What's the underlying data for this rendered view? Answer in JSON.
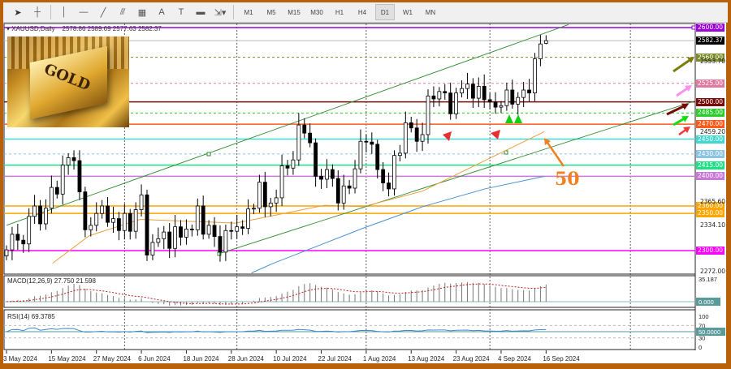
{
  "toolbar": {
    "tools": [
      "cursor-icon",
      "crosshair-icon",
      "vertical-line-icon",
      "horizontal-line-icon",
      "trendline-icon",
      "fibonacci-icon",
      "fibo-fan-icon",
      "text-icon",
      "text-label-icon",
      "rectangle-icon",
      "arrows-icon"
    ],
    "text_tool": "A",
    "timeframes": [
      "M1",
      "M5",
      "M15",
      "M30",
      "H1",
      "H4",
      "D1",
      "W1",
      "MN"
    ],
    "active_timeframe": "D1"
  },
  "header": {
    "symbol": "XAUUSD,Daily",
    "ohlc": "2578.86 2589.69 2577.63 2582.37"
  },
  "image": {
    "logo_text": "GOLD"
  },
  "annotation_label": "50",
  "colors": {
    "up_body": "#ffffff",
    "down_body": "#000000",
    "ma_orange": "#e8a040",
    "ma_blue": "#4a90d0",
    "channel": "#2e8b2e",
    "frame": "#b8600a"
  },
  "chart_data": {
    "type": "candlestick",
    "title": "XAUUSD,Daily",
    "ylim": [
      2262,
      2610
    ],
    "last_candle": {
      "open": 2578.86,
      "high": 2589.69,
      "low": 2577.63,
      "close": 2582.37
    },
    "closes": [
      2301,
      2322,
      2314,
      2309,
      2346,
      2360,
      2336,
      2357,
      2385,
      2376,
      2415,
      2425,
      2421,
      2379,
      2328,
      2334,
      2350,
      2360,
      2338,
      2343,
      2327,
      2350,
      2326,
      2355,
      2375,
      2294,
      2311,
      2316,
      2325,
      2303,
      2332,
      2318,
      2329,
      2328,
      2360,
      2322,
      2334,
      2319,
      2298,
      2327,
      2326,
      2332,
      2330,
      2356,
      2357,
      2392,
      2359,
      2364,
      2371,
      2414,
      2411,
      2422,
      2469,
      2458,
      2445,
      2400,
      2396,
      2409,
      2397,
      2364,
      2387,
      2384,
      2410,
      2447,
      2446,
      2443,
      2409,
      2391,
      2383,
      2428,
      2431,
      2472,
      2465,
      2447,
      2456,
      2508,
      2504,
      2514,
      2512,
      2484,
      2512,
      2518,
      2524,
      2505,
      2521,
      2503,
      2500,
      2493,
      2495,
      2516,
      2497,
      2506,
      2516,
      2512,
      2558,
      2578,
      2582.37
    ],
    "x_tick_labels": [
      {
        "index": 0,
        "label": "3 May 2024"
      },
      {
        "index": 8,
        "label": "15 May 2024"
      },
      {
        "index": 16,
        "label": "27 May 2024"
      },
      {
        "index": 24,
        "label": "6 Jun 2024"
      },
      {
        "index": 32,
        "label": "18 Jun 2024"
      },
      {
        "index": 40,
        "label": "28 Jun 2024"
      },
      {
        "index": 48,
        "label": "10 Jul 2024"
      },
      {
        "index": 56,
        "label": "22 Jul 2024"
      },
      {
        "index": 64,
        "label": "1 Aug 2024"
      },
      {
        "index": 72,
        "label": "13 Aug 2024"
      },
      {
        "index": 80,
        "label": "23 Aug 2024"
      },
      {
        "index": 88,
        "label": "4 Sep 2024"
      },
      {
        "index": 96,
        "label": "16 Sep 2024"
      }
    ],
    "month_separators": [
      21,
      41,
      64,
      86,
      111
    ],
    "y_axis_labels": [
      "2553.70",
      "2459.20",
      "2365.60",
      "2334.10",
      "2272.00"
    ],
    "levels": [
      {
        "price": 2600,
        "label": "2600.00",
        "color": "#9a00d8",
        "style": "solid"
      },
      {
        "price": 2582.37,
        "label": "2582.37",
        "color": "#000000",
        "style": "current"
      },
      {
        "price": 2560,
        "label": "2560.00",
        "color": "#7c8c2c",
        "style": "dashed"
      },
      {
        "price": 2525,
        "label": "2525.00",
        "color": "#e07aa0",
        "style": "dashed"
      },
      {
        "price": 2500,
        "label": "2500.00",
        "color": "#7a0a0a",
        "style": "solid"
      },
      {
        "price": 2485,
        "label": "2485.00",
        "color": "#2ecc2e",
        "style": "dashed"
      },
      {
        "price": 2470,
        "label": "2470.00",
        "color": "#ff5a1a",
        "style": "solid"
      },
      {
        "price": 2450,
        "label": "2450.00",
        "color": "#40d8d0",
        "style": "solid"
      },
      {
        "price": 2430,
        "label": "2430.00",
        "color": "#8cc4e6",
        "style": "dashed"
      },
      {
        "price": 2415,
        "label": "2415.00",
        "color": "#1ee084",
        "style": "solid"
      },
      {
        "price": 2400,
        "label": "2400.00",
        "color": "#c878d8",
        "style": "solid"
      },
      {
        "price": 2360,
        "label": "2360.00",
        "color": "#ffa500",
        "style": "solid"
      },
      {
        "price": 2350,
        "label": "2350.00",
        "color": "#ffa500",
        "style": "solid"
      },
      {
        "price": 2300,
        "label": "2300.00",
        "color": "#ff00ff",
        "style": "solid"
      }
    ],
    "moving_averages": [
      {
        "name": "MA 50",
        "color": "#e8a040",
        "points": [
          [
            8.2,
            2283
          ],
          [
            14.7,
            2320
          ],
          [
            23.8,
            2342
          ],
          [
            40.8,
            2337
          ],
          [
            56.6,
            2361
          ],
          [
            63.4,
            2359
          ],
          [
            74,
            2380
          ],
          [
            85.1,
            2421
          ],
          [
            95.7,
            2460
          ]
        ]
      },
      {
        "name": "MA 100",
        "color": "#4a90d0",
        "points": [
          [
            43.6,
            2270
          ],
          [
            47.5,
            2283
          ],
          [
            63.4,
            2330
          ],
          [
            74,
            2359
          ],
          [
            85.1,
            2383
          ],
          [
            95.7,
            2400
          ]
        ]
      }
    ],
    "trendlines": [
      {
        "name": "channel-upper",
        "from": [
          0,
          2334
        ],
        "to": [
          100,
          2604
        ]
      },
      {
        "name": "channel-lower",
        "from": [
          37.9,
          2296
        ],
        "to": [
          122.4,
          2501
        ]
      }
    ],
    "indicators": {
      "macd": {
        "label": "MACD(12,26,9) 27.750 21.598",
        "axis_top": "35.187",
        "axis_zero": "0.000",
        "max": 35.187
      },
      "rsi": {
        "label": "RSI(14) 69.3785",
        "levels": [
          "100",
          "70",
          "50.0000",
          "30",
          "0"
        ]
      }
    }
  }
}
